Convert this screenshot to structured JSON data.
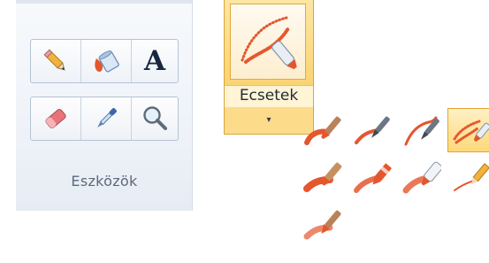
{
  "tools": {
    "group_label": "Eszközök",
    "items": [
      {
        "id": "pencil",
        "icon": "pencil-icon"
      },
      {
        "id": "fill",
        "icon": "paint-bucket-icon"
      },
      {
        "id": "text",
        "icon": "text-icon",
        "glyph": "A"
      },
      {
        "id": "eraser",
        "icon": "eraser-icon"
      },
      {
        "id": "color-picker",
        "icon": "eyedropper-icon"
      },
      {
        "id": "magnifier",
        "icon": "magnifier-icon"
      }
    ]
  },
  "brushes": {
    "label": "Ecsetek",
    "arrow": "▾",
    "state": "pressed",
    "gallery": [
      {
        "icon": "brush-icon",
        "selected": false
      },
      {
        "icon": "calligraphy-brush-1-icon",
        "selected": false
      },
      {
        "icon": "calligraphy-brush-2-icon",
        "selected": false
      },
      {
        "icon": "airbrush-icon",
        "selected": true
      },
      {
        "icon": "oil-brush-icon",
        "selected": false
      },
      {
        "icon": "crayon-icon",
        "selected": false
      },
      {
        "icon": "marker-icon",
        "selected": false
      },
      {
        "icon": "natural-pencil-icon",
        "selected": false
      },
      {
        "icon": "watercolor-brush-icon",
        "selected": false
      }
    ]
  },
  "colors": {
    "accent_orange": "#e4572e",
    "selection": "#fcd97b",
    "selection_border": "#e1a531"
  }
}
